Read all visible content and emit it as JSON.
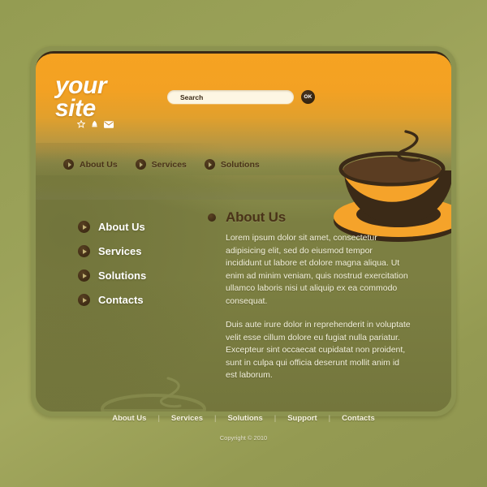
{
  "site": {
    "logo_line1": "your",
    "logo_line2": "site",
    "logo_icons": [
      "star-icon",
      "bell-icon",
      "envelope-icon"
    ]
  },
  "search": {
    "placeholder": "Search",
    "value": "",
    "submit_label": "OK"
  },
  "top_nav": {
    "items": [
      {
        "label": "About Us"
      },
      {
        "label": "Services"
      },
      {
        "label": "Solutions"
      }
    ]
  },
  "sidebar": {
    "items": [
      {
        "label": "About Us"
      },
      {
        "label": "Services"
      },
      {
        "label": "Solutions"
      },
      {
        "label": "Contacts"
      }
    ]
  },
  "main": {
    "title": "About Us",
    "paragraphs": [
      "Lorem ipsum dolor sit amet, consectetur adipisicing elit, sed do eiusmod tempor incididunt ut labore et dolore magna aliqua. Ut enim ad minim veniam, quis nostrud exercitation ullamco laboris nisi ut aliquip ex ea commodo consequat.",
      "Duis aute irure dolor in reprehenderit in voluptate velit esse cillum dolore eu fugiat nulla pariatur. Excepteur sint occaecat cupidatat non proident, sunt in culpa qui officia deserunt mollit anim id est laborum."
    ]
  },
  "footer": {
    "links": [
      {
        "label": "About Us"
      },
      {
        "label": "Services"
      },
      {
        "label": "Solutions"
      },
      {
        "label": "Support"
      },
      {
        "label": "Contacts"
      }
    ],
    "separator": "|",
    "copyright": "Copyright © 2010"
  },
  "graphics": {
    "main_cup": "coffee-cup-illustration",
    "watermark_cup": "coffee-cup-watermark"
  },
  "colors": {
    "page_background": "#99a055",
    "header_orange": "#f5a024",
    "card_olive": "#7c7d3d",
    "dark_brown": "#3c2a14",
    "cup_orange": "#f5a32a",
    "text_cream": "#f2f0dc"
  }
}
